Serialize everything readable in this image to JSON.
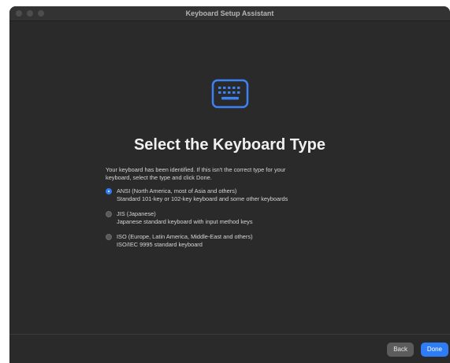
{
  "window": {
    "title": "Keyboard Setup Assistant"
  },
  "main": {
    "heading": "Select the Keyboard Type",
    "intro_line1": "Your keyboard has been identified. If this isn't the correct type for your",
    "intro_line2": "keyboard, select the type and click Done.",
    "options": [
      {
        "label": "ANSI (North America, most of Asia and others)",
        "description": "Standard 101-key or 102-key keyboard and some other keyboards",
        "selected": true
      },
      {
        "label": "JIS (Japanese)",
        "description": "Japanese standard keyboard with input method keys",
        "selected": false
      },
      {
        "label": "ISO (Europe, Latin America, Middle-East and others)",
        "description": "ISO/IEC 9995 standard keyboard",
        "selected": false
      }
    ]
  },
  "footer": {
    "back_label": "Back",
    "done_label": "Done"
  },
  "colors": {
    "background": "#2a2a2a",
    "accent": "#2f7df6",
    "icon_blue": "#3b82f6"
  },
  "icons": {
    "keyboard": "keyboard-icon"
  }
}
